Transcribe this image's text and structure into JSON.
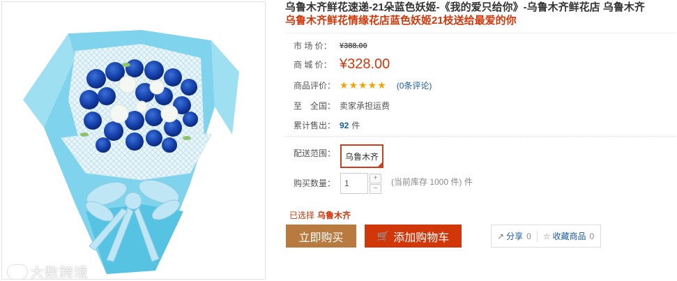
{
  "product": {
    "title": "乌鲁木齐鲜花速递-21朵蓝色妖姬-《我的爱只给你》-乌鲁木齐鲜花店 乌鲁木齐",
    "subtitle": "乌鲁木齐鲜花情缘花店蓝色妖姬21枝送给最爱的你"
  },
  "watermark": "大数跨境",
  "info": {
    "market_price_label": "市 场 价：",
    "market_price": "¥388.00",
    "shop_price_label": "商 城 价：",
    "shop_price": "¥328.00",
    "rating_label": "商品评价：",
    "rating_stars": "★★★★★",
    "rating_value": 5,
    "review_link": "(0条评论)",
    "shipping_label": "至　全国：",
    "shipping_value": "卖家承担运费",
    "sold_label": "累计售出：",
    "sold_count": "92",
    "sold_unit": "件"
  },
  "delivery": {
    "label": "配送范围：",
    "city": "乌鲁木齐"
  },
  "quantity": {
    "label": "购买数量：",
    "value": "1",
    "plus": "+",
    "minus": "−",
    "stock": "(当前库存 1000 件) 件"
  },
  "selection": {
    "prefix": "已选择",
    "value": "乌鲁木齐"
  },
  "buttons": {
    "buy_now": "立即购买",
    "add_cart": "添加购物车"
  },
  "share": {
    "share_label": "分享",
    "share_count": "0",
    "fav_label": "收藏商品",
    "fav_count": "0"
  },
  "colors": {
    "accent_red": "#d2370a",
    "buy_brown": "#b87a3f",
    "link_blue": "#1a5aa0",
    "star_gold": "#f4a300"
  }
}
